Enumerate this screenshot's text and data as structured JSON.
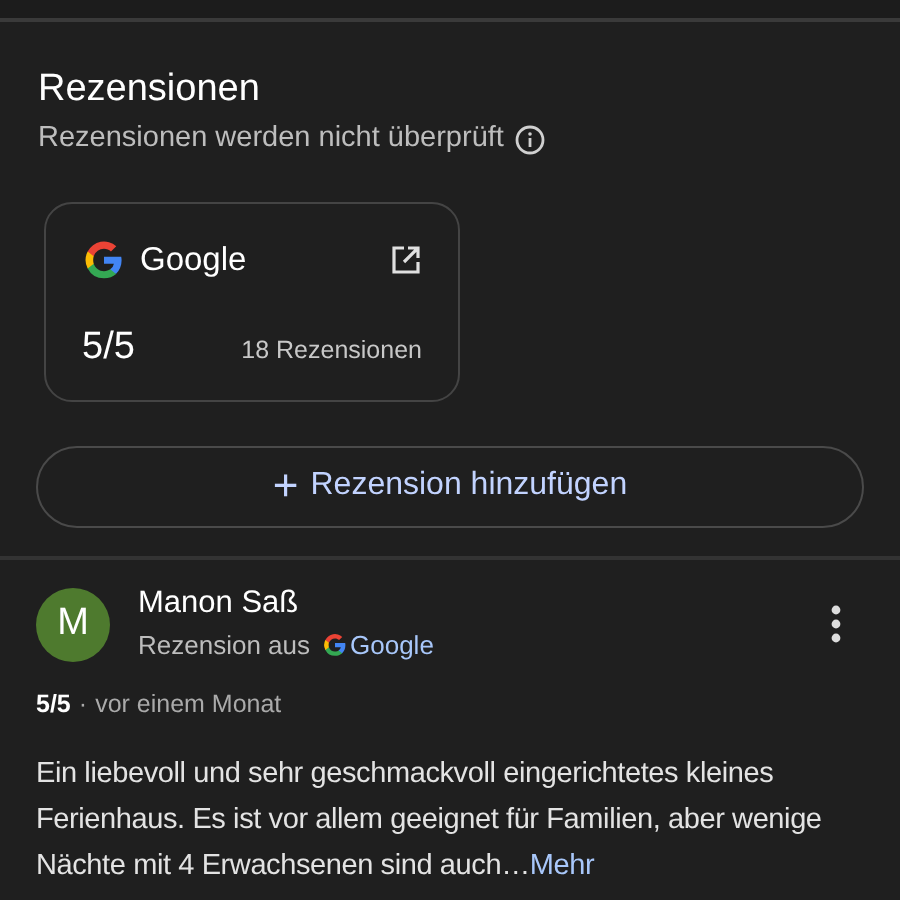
{
  "section": {
    "title": "Rezensionen",
    "subtitle": "Rezensionen werden nicht überprüft"
  },
  "source_card": {
    "name": "Google",
    "score": "5/5",
    "count": "18 Rezensionen"
  },
  "add_button": {
    "icon": "+",
    "label": "Rezension hinzufügen"
  },
  "reviews": [
    {
      "initial": "M",
      "color": "#4e7a2e",
      "author": "Manon Saß",
      "source_prefix": "Rezension aus",
      "source": "Google",
      "score": "5/5",
      "separator": "·",
      "time": "vor einem Monat",
      "text": "Ein liebevoll und sehr geschmackvoll eingerichtetes kleines Ferienhaus. Es ist vor allem geeignet für Familien, aber wenige Nächte mit 4 Erwachsenen sind auch…",
      "more": "Mehr"
    }
  ]
}
